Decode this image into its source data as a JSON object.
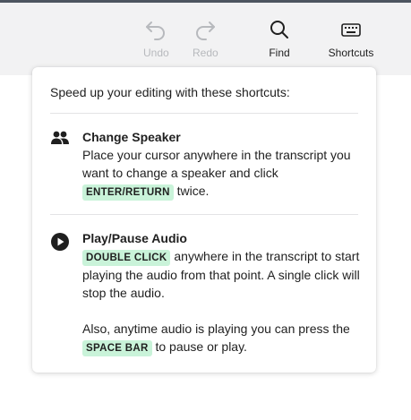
{
  "toolbar": {
    "undo_label": "Undo",
    "redo_label": "Redo",
    "find_label": "Find",
    "shortcuts_label": "Shortcuts"
  },
  "popover": {
    "intro": "Speed up your editing with these shortcuts:",
    "change_speaker": {
      "title": "Change Speaker",
      "text_before": "Place your cursor anywhere in the transcript you want to change a speaker and click",
      "key": "ENTER/RETURN",
      "text_after": "twice."
    },
    "play_pause": {
      "title": "Play/Pause Audio",
      "key": "DOUBLE CLICK",
      "text_after_key": "anywhere in the transcript to start playing the audio from that point. A single click will stop the audio.",
      "text2_before": "Also, anytime audio is playing you can press the",
      "key2": "SPACE BAR",
      "text2_after": "to pause or play."
    }
  },
  "colors": {
    "toolbar_bg": "#f2f2f3",
    "key_highlight": "#c9f3d9",
    "disabled_text": "#b7b9bd"
  }
}
